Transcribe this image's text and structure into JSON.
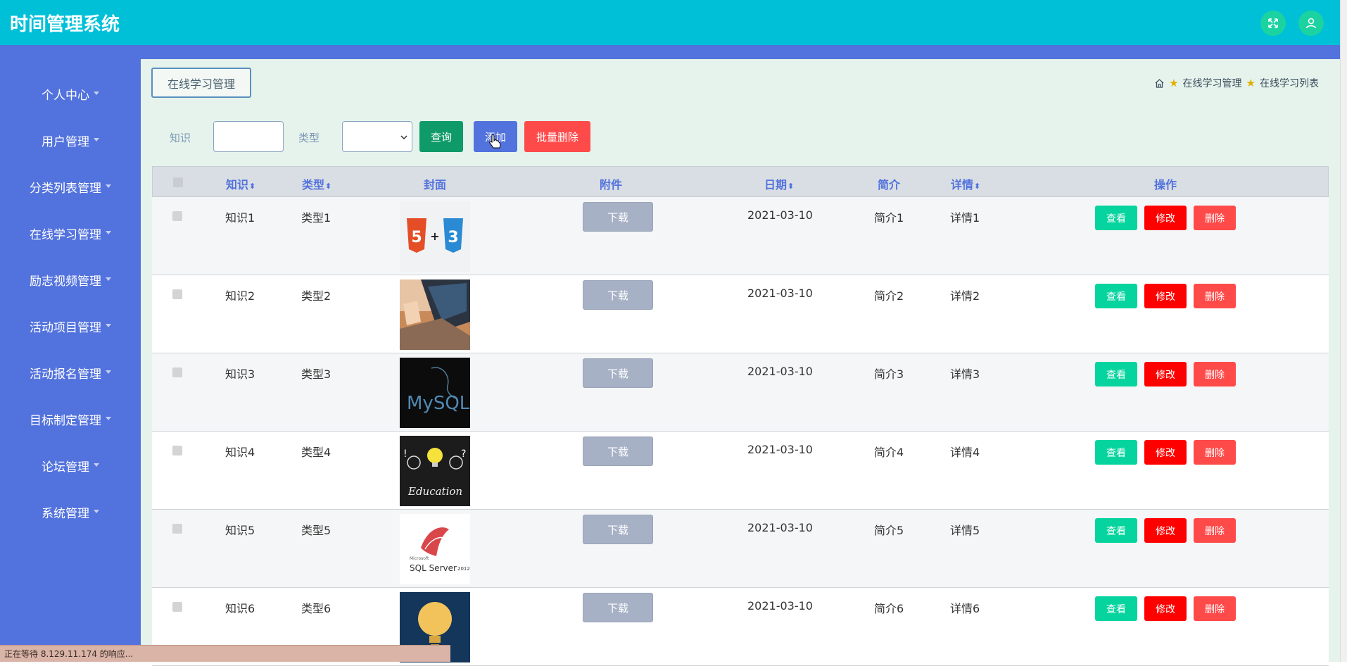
{
  "app": {
    "title": "时间管理系统"
  },
  "topbar": {
    "fullscreen_icon": "fullscreen-icon",
    "user_icon": "user-icon"
  },
  "sidebar": {
    "items": [
      {
        "label": "个人中心"
      },
      {
        "label": "用户管理"
      },
      {
        "label": "分类列表管理"
      },
      {
        "label": "在线学习管理"
      },
      {
        "label": "励志视频管理"
      },
      {
        "label": "活动项目管理"
      },
      {
        "label": "活动报名管理"
      },
      {
        "label": "目标制定管理"
      },
      {
        "label": "论坛管理"
      },
      {
        "label": "系统管理"
      }
    ]
  },
  "page": {
    "tag": "在线学习管理",
    "breadcrumb": [
      "在线学习管理",
      "在线学习列表"
    ]
  },
  "search": {
    "knowledge_label": "知识",
    "knowledge_value": "",
    "type_label": "类型",
    "type_value": "",
    "query_button": "查询",
    "add_button": "添加",
    "batch_delete_button": "批量删除"
  },
  "table": {
    "headers": {
      "knowledge": "知识",
      "type": "类型",
      "cover": "封面",
      "attachment": "附件",
      "date": "日期",
      "summary": "简介",
      "details": "详情",
      "actions": "操作"
    },
    "sort_icon": "sort-icon",
    "download_label": "下载",
    "view_label": "查看",
    "edit_label": "修改",
    "delete_label": "删除",
    "rows": [
      {
        "knowledge": "知识1",
        "type": "类型1",
        "cover": "html5-css3-logo",
        "date": "2021-03-10",
        "summary": "简介1",
        "details": "详情1"
      },
      {
        "knowledge": "知识2",
        "type": "类型2",
        "cover": "laptop-coding-photo",
        "date": "2021-03-10",
        "summary": "简介2",
        "details": "详情2"
      },
      {
        "knowledge": "知识3",
        "type": "类型3",
        "cover": "mysql-logo",
        "date": "2021-03-10",
        "summary": "简介3",
        "details": "详情3"
      },
      {
        "knowledge": "知识4",
        "type": "类型4",
        "cover": "education-lightbulb",
        "date": "2021-03-10",
        "summary": "简介4",
        "details": "详情4"
      },
      {
        "knowledge": "知识5",
        "type": "类型5",
        "cover": "sqlserver-logo",
        "date": "2021-03-10",
        "summary": "简介5",
        "details": "详情5"
      },
      {
        "knowledge": "知识6",
        "type": "类型6",
        "cover": "lightbulb-book",
        "date": "2021-03-10",
        "summary": "简介6",
        "details": "详情6"
      }
    ]
  },
  "cover_text": {
    "mysql": "MySQL",
    "education": "Education",
    "sqlserver_small": "Microsoft",
    "sqlserver": "SQL Server",
    "sqlserver_year": "2012"
  },
  "status": {
    "text": "正在等待 8.129.11.174 的响应..."
  },
  "colors": {
    "topbar": "#00c0d8",
    "sidebar": "#5272dd",
    "content_bg": "#e5f3ec",
    "query": "#0f9a6a",
    "add": "#5272dd",
    "batch_delete": "#ff4a4a",
    "view": "#06d49e",
    "edit": "#ff0000",
    "delete": "#ff4a4a",
    "download": "#a7b1c6"
  }
}
